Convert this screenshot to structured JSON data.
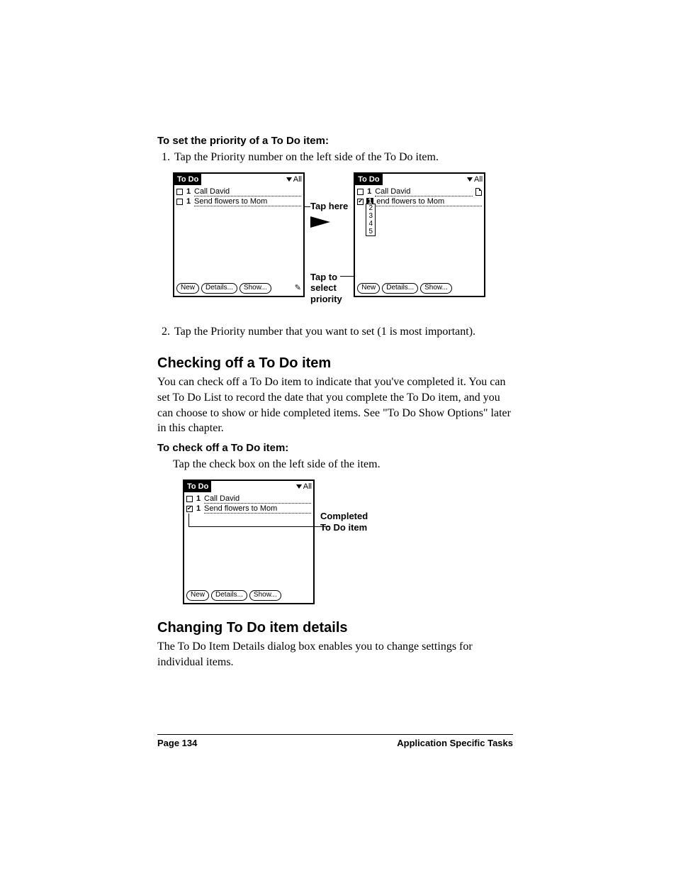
{
  "proc1_heading": "To set the priority of a To Do item:",
  "step1": "Tap the Priority number on the left side of the To Do item.",
  "step2": "Tap the Priority number that you want to set (1 is most important).",
  "callout_tap_here": "Tap here",
  "callout_tap_select": "Tap to\nselect\npriority",
  "h2_checking": "Checking off a To Do item",
  "checking_body": "You can check off a To Do item to indicate that you've completed it. You can set To Do List to record the date that you complete the To Do item, and you can choose to show or hide completed items. See \"To Do Show Options\" later in this chapter.",
  "proc2_heading": "To check off a To Do item:",
  "proc2_step": "Tap the check box on the left side of the item.",
  "callout_completed": "Completed\nTo Do item",
  "h2_changing": "Changing To Do item details",
  "changing_body": "The To Do Item Details dialog box enables you to change settings for individual items.",
  "footer_left": "Page 134",
  "footer_right": "Application Specific Tasks",
  "palm": {
    "title": "To Do",
    "cat": "All",
    "btn_new": "New",
    "btn_details": "Details...",
    "btn_show": "Show...",
    "item1": "Call David",
    "item2": "Send flowers to Mom",
    "item2b": "end flowers to Mom",
    "p1": "1",
    "pop": [
      "2",
      "3",
      "4",
      "5"
    ]
  }
}
